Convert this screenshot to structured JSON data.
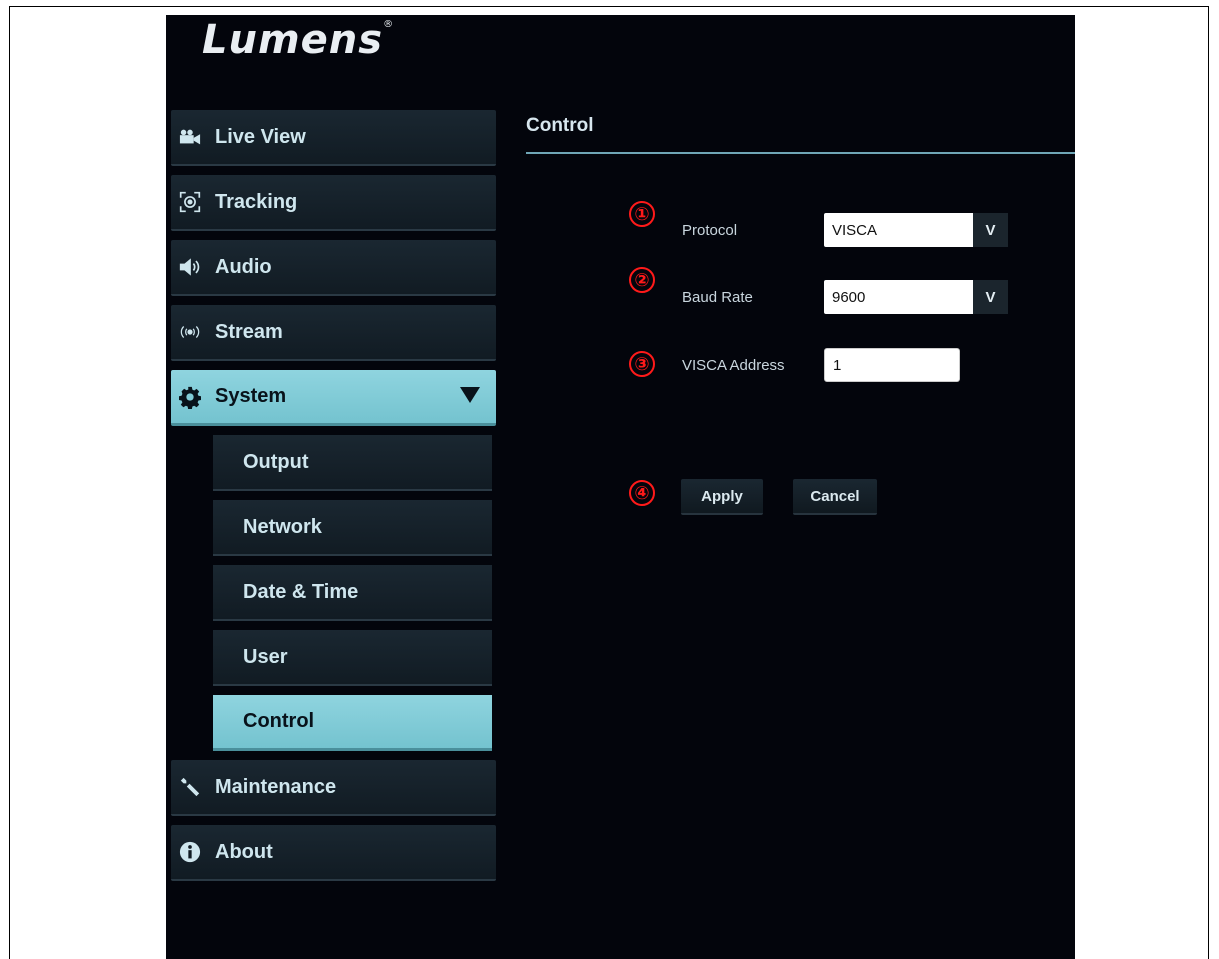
{
  "brand": {
    "logo_text": "Lumens",
    "registered": "®"
  },
  "sidebar": {
    "items": [
      {
        "label": "Live View",
        "icon": "video-camera-icon"
      },
      {
        "label": "Tracking",
        "icon": "tracking-target-icon"
      },
      {
        "label": "Audio",
        "icon": "speaker-icon"
      },
      {
        "label": "Stream",
        "icon": "broadcast-icon"
      },
      {
        "label": "System",
        "icon": "gear-icon",
        "expanded": true
      },
      {
        "label": "Maintenance",
        "icon": "wrench-icon"
      },
      {
        "label": "About",
        "icon": "info-icon"
      }
    ],
    "system_sub": [
      {
        "label": "Output"
      },
      {
        "label": "Network"
      },
      {
        "label": "Date & Time"
      },
      {
        "label": "User"
      },
      {
        "label": "Control",
        "active": true
      }
    ]
  },
  "content": {
    "title": "Control",
    "markers": [
      "①",
      "②",
      "③",
      "④"
    ],
    "protocol": {
      "label": "Protocol",
      "value": "VISCA"
    },
    "baud_rate": {
      "label": "Baud Rate",
      "value": "9600"
    },
    "visca_address": {
      "label": "VISCA Address",
      "value": "1"
    },
    "apply_label": "Apply",
    "cancel_label": "Cancel",
    "dropdown_glyph": "V"
  },
  "colors": {
    "background": "#03050c",
    "accent": "#7fcbd6",
    "marker": "#ff1a1a"
  }
}
